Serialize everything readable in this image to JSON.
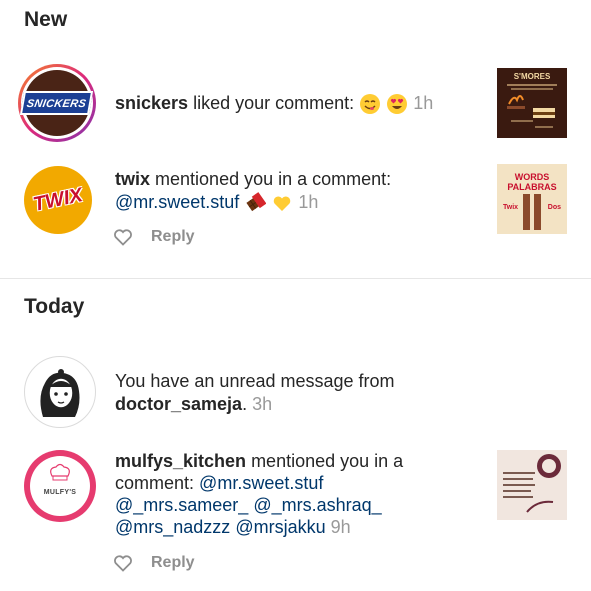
{
  "sections": {
    "new_title": "New",
    "today_title": "Today"
  },
  "notifications": [
    {
      "username": "snickers",
      "action": "liked your comment:",
      "time": "1h",
      "avatar_text": "SNICKERS",
      "thumb_title": "S'MORES"
    },
    {
      "username": "twix",
      "action": "mentioned you in a comment:",
      "mention": "@mr.sweet.stuf",
      "time": "1h",
      "avatar_text": "TWIX",
      "thumb_title": "WORDS PALABRAS",
      "thumb_left": "Twix",
      "thumb_right": "Dos",
      "reply_label": "Reply"
    },
    {
      "prefix": "You have an unread message from",
      "username": "doctor_sameja",
      "suffix": ".",
      "time": "3h"
    },
    {
      "username": "mulfys_kitchen",
      "action": "mentioned you in a",
      "line2_prefix": "comment:",
      "mention1": "@mr.sweet.stuf",
      "mention2": "@_mrs.sameer_",
      "mention3": "@_mrs.ashraq_",
      "mention4": "@mrs_nadzzz",
      "mention5": "@mrsjakku",
      "time": "9h",
      "avatar_text": "MULFY'S",
      "reply_label": "Reply"
    }
  ],
  "colors": {
    "text": "#262626",
    "muted": "#999999",
    "mention": "#00376b",
    "story_ring_start": "#f58529",
    "story_ring_end": "#dd2a7b",
    "snickers_brown": "#4a2416",
    "twix_gold": "#f2a900",
    "twix_red": "#c8102e"
  }
}
